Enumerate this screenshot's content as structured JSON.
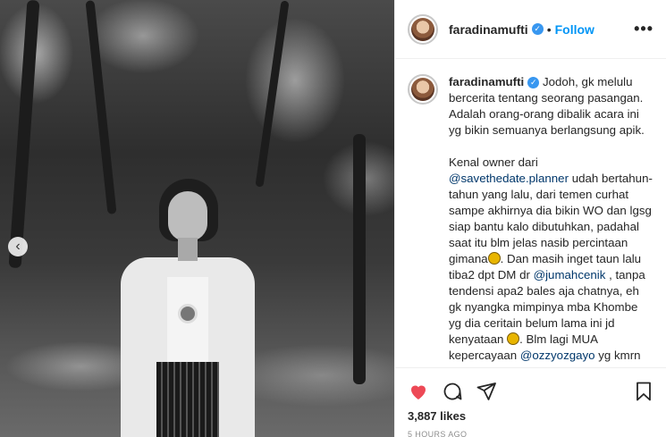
{
  "post": {
    "username": "faradinamufti",
    "follow_label": "Follow",
    "separator": "•",
    "more_label": "•••",
    "caption_paragraphs": [
      [
        {
          "t": "text",
          "v": "Jodoh, gk melulu bercerita tentang seorang pasangan. Adalah orang-orang dibalik acara ini yg bikin semuanya berlangsung apik."
        }
      ],
      [
        {
          "t": "text",
          "v": "Kenal owner dari "
        },
        {
          "t": "mention",
          "v": "@savethedate.planner"
        },
        {
          "t": "text",
          "v": " udah bertahun-tahun yang lalu, dari temen curhat sampe akhirnya dia bikin WO dan lgsg siap bantu kalo dibutuhkan, padahal saat itu blm jelas nasib percintaan gimana"
        },
        {
          "t": "emoji",
          "v": "grinning-sweat-emoji"
        },
        {
          "t": "text",
          "v": ". Dan masih inget taun lalu tiba2 dpt DM dr "
        },
        {
          "t": "mention",
          "v": "@jumahcenik"
        },
        {
          "t": "text",
          "v": " , tanpa tendensi apa2 bales aja chatnya, eh gk nyangka mimpinya mba Khombe yg dia ceritain belum lama ini jd kenyataan "
        },
        {
          "t": "emoji",
          "v": "smiling-emoji"
        },
        {
          "t": "text",
          "v": ". Blm lagi MUA kepercayaan "
        },
        {
          "t": "mention",
          "v": "@ozzyozgayo"
        },
        {
          "t": "text",
          "v": " yg kmrn hampir aja bentrok schedule, untung acaraku"
        }
      ]
    ],
    "likes": "3,887 likes",
    "time": "5 HOURS AGO"
  },
  "colors": {
    "accent": "#0095f6",
    "like_heart": "#ed4956",
    "mention": "#00376b",
    "verified": "#3897f0"
  },
  "icons": {
    "carousel_prev": "chevron-left-icon",
    "like": "heart-icon",
    "comment": "comment-icon",
    "share": "paper-plane-icon",
    "save": "bookmark-icon"
  }
}
